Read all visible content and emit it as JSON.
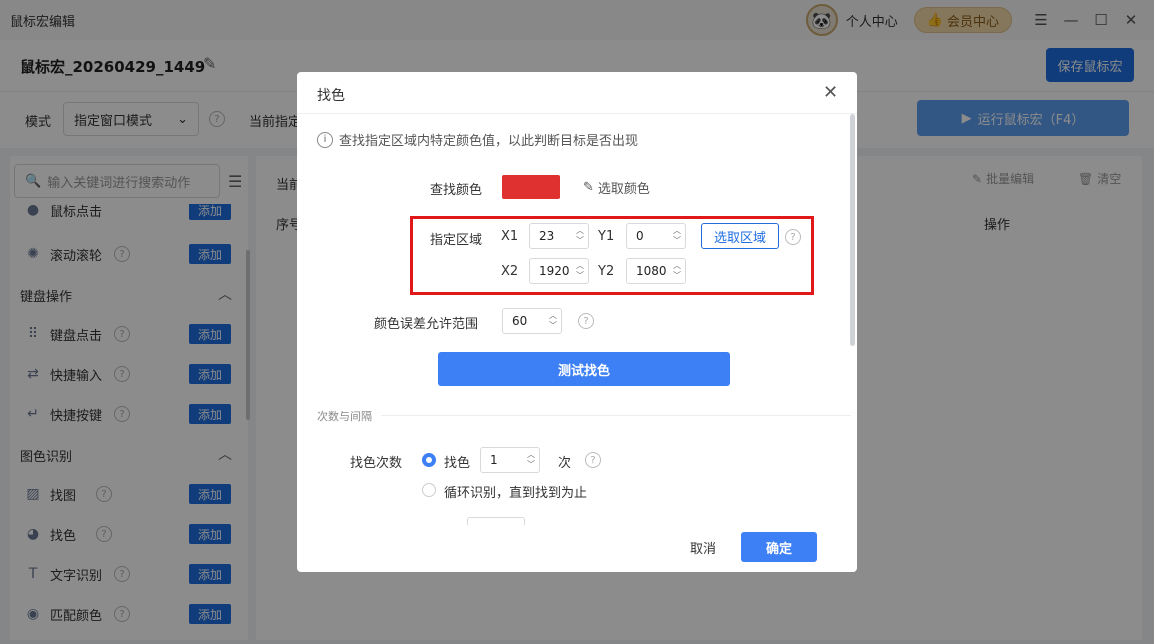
{
  "window": {
    "title": "鼠标宏编辑",
    "profile_label": "个人中心",
    "vip_label": "会员中心"
  },
  "header": {
    "macro_name": "鼠标宏_20260429_1449",
    "save_label": "保存鼠标宏",
    "mode_label": "模式",
    "mode_value": "指定窗口模式",
    "current_label": "当前指定",
    "run_label": "运行鼠标宏（F4）"
  },
  "sidebar": {
    "search_placeholder": "输入关键词进行搜索动作",
    "add_label": "添加",
    "items_top": [
      {
        "label": "鼠标点击",
        "icon": "mouse-click-icon"
      },
      {
        "label": "滚动滚轮",
        "icon": "scroll-wheel-icon"
      }
    ],
    "group_keyboard": "键盘操作",
    "items_keyboard": [
      {
        "label": "键盘点击",
        "icon": "keyboard-icon"
      },
      {
        "label": "快捷输入",
        "icon": "quick-input-icon"
      },
      {
        "label": "快捷按键",
        "icon": "hotkey-icon"
      }
    ],
    "group_image": "图色识别",
    "items_image": [
      {
        "label": "找图",
        "icon": "image-icon"
      },
      {
        "label": "找色",
        "icon": "palette-icon"
      },
      {
        "label": "文字识别",
        "icon": "text-recognition-icon"
      },
      {
        "label": "匹配颜色",
        "icon": "match-color-icon"
      }
    ]
  },
  "main": {
    "current_label": "当前",
    "batch_edit": "批量编辑",
    "clear": "清空",
    "col_seq": "序号",
    "col_op": "操作"
  },
  "dialog": {
    "title": "找色",
    "info": "查找指定区域内特定颜色值，以此判断目标是否出现",
    "find_color_label": "查找颜色",
    "find_color_value": "#e03131",
    "pick_color_label": "选取颜色",
    "area_label": "指定区域",
    "x1_label": "X1",
    "x1": "23",
    "y1_label": "Y1",
    "y1": "0",
    "x2_label": "X2",
    "x2": "1920",
    "y2_label": "Y2",
    "y2": "1080",
    "select_area_label": "选取区域",
    "tolerance_label": "颜色误差允许范围",
    "tolerance": "60",
    "test_label": "测试找色",
    "section_label": "次数与间隔",
    "count_label": "找色次数",
    "count_option_label": "找色",
    "count_value": "1",
    "count_unit": "次",
    "loop_option_label": "循环识别，直到找到为止",
    "cancel_label": "取消",
    "ok_label": "确定"
  },
  "colors": {
    "primary": "#1e6ee0",
    "dialog_button": "#3d7ff4",
    "highlight": "#e01818"
  }
}
